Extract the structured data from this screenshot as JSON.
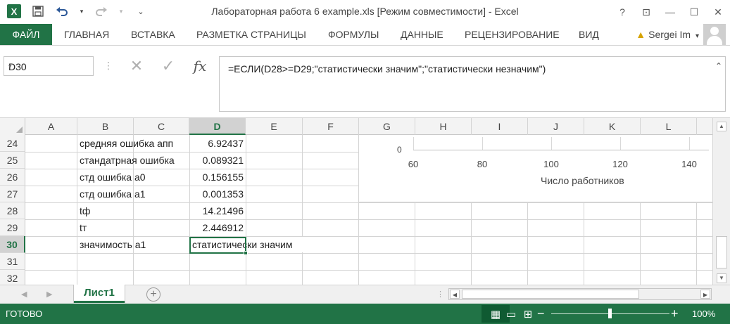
{
  "app": {
    "title": "Лабораторная работа 6 example.xls  [Режим совместимости] - Excel",
    "logo": "X",
    "help": "?",
    "ribbon_toggle": "⊡",
    "minimize": "—",
    "maximize": "☐",
    "close": "✕"
  },
  "qat": {
    "save_icon": "save-icon",
    "undo_icon": "undo-icon",
    "redo_icon": "redo-icon",
    "customize": "⌄"
  },
  "ribbon": {
    "tabs": [
      "ФАЙЛ",
      "ГЛАВНАЯ",
      "ВСТАВКА",
      "РАЗМЕТКА СТРАНИЦЫ",
      "ФОРМУЛЫ",
      "ДАННЫЕ",
      "РЕЦЕНЗИРОВАНИЕ",
      "ВИД"
    ],
    "user": "Sergei Im",
    "user_dropdown": "▾"
  },
  "formula_bar": {
    "name_box": "D30",
    "name_dropdown": "▾",
    "separator": "⋮",
    "cancel": "✕",
    "enter": "✓",
    "fx": "fx",
    "formula": "=ЕСЛИ(D28>=D29;\"статистически значим\";\"статистически незначим\")",
    "collapse": "⌃"
  },
  "grid": {
    "columns": [
      "A",
      "B",
      "C",
      "D",
      "E",
      "F",
      "G",
      "H",
      "I",
      "J",
      "K",
      "L"
    ],
    "active_column": "D",
    "rows": [
      "24",
      "25",
      "26",
      "27",
      "28",
      "29",
      "30",
      "31",
      "32"
    ],
    "active_row": "30",
    "labels": [
      "средняя ошибка апп",
      "стандатрная ошибка",
      "стд ошибка а0",
      "стд ошибка а1",
      "tф",
      "tт",
      "значимость а1",
      "",
      ""
    ],
    "values": [
      "6.92437",
      "0.089321",
      "0.156155",
      "0.001353",
      "14.21496",
      "2.446912",
      "статистически значим",
      "",
      ""
    ]
  },
  "chart_fragment": {
    "y_tick": "0",
    "x_ticks": [
      "60",
      "80",
      "100",
      "120",
      "140"
    ],
    "x_title": "Число работников"
  },
  "sheets": {
    "tabs": [
      "Лист1"
    ],
    "active": "Лист1",
    "add": "+",
    "prev": "◀",
    "next": "▶"
  },
  "status": {
    "ready": "ГОТОВО",
    "zoom": "100%",
    "zoom_minus": "−",
    "zoom_plus": "+",
    "view_normal": "▦",
    "view_layout": "▭",
    "view_break": "⊞"
  },
  "colors": {
    "accent": "#217346"
  }
}
